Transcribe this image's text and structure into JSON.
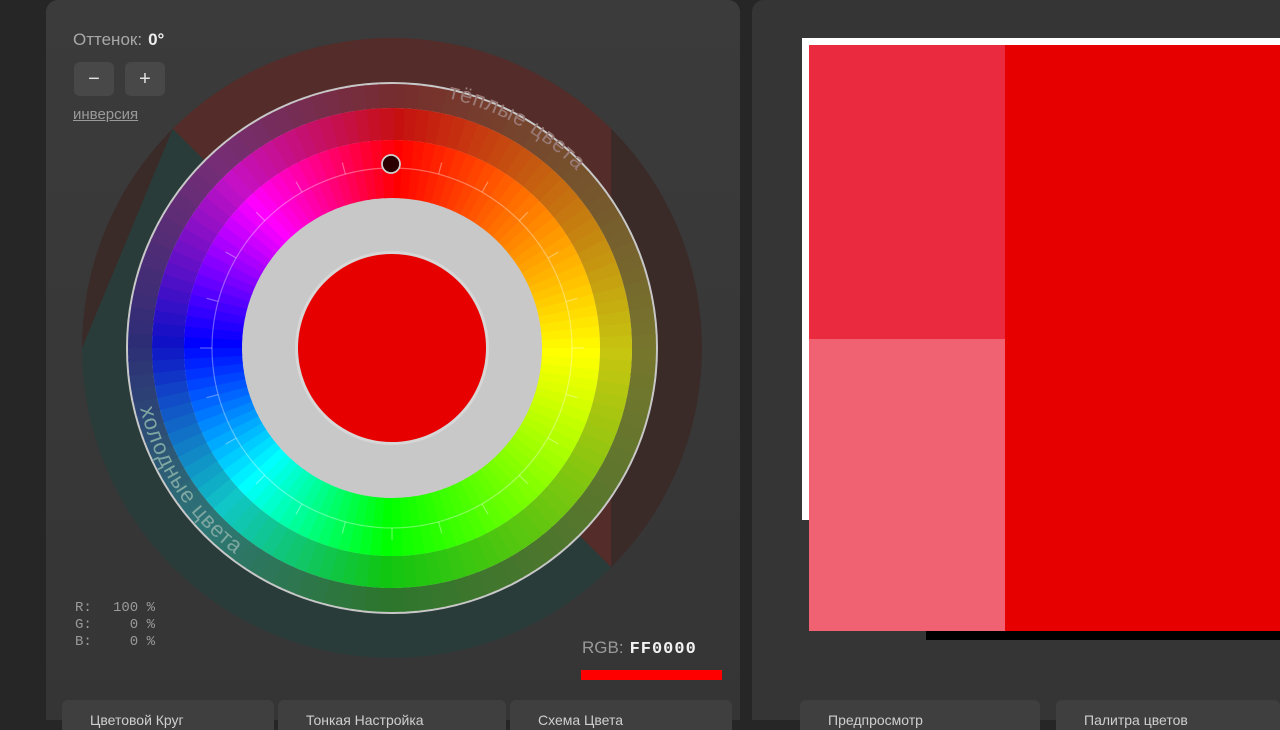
{
  "hue": {
    "label": "Оттенок:",
    "value": "0°"
  },
  "buttons": {
    "minus": "−",
    "plus": "+"
  },
  "invert_label": "инверсия",
  "wheel": {
    "warm_label": "тёплые цвета",
    "cold_label": "холодные цвета",
    "selected_hue_deg": 0,
    "center_color": "#e60000"
  },
  "rgb": [
    {
      "channel": "R:",
      "value": "100 %"
    },
    {
      "channel": "G:",
      "value": "0 %"
    },
    {
      "channel": "B:",
      "value": "0 %"
    }
  ],
  "hex": {
    "label": "RGB:",
    "value": "FF0000",
    "color": "#ff0000"
  },
  "tabs": [
    {
      "label": "Цветовой Круг"
    },
    {
      "label": "Тонкая Настройка"
    },
    {
      "label": "Схема Цвета"
    }
  ],
  "right_tabs": [
    {
      "label": "Предпросмотр"
    },
    {
      "label": "Палитра цветов"
    }
  ],
  "swatches": {
    "top_left": "#ea2a3e",
    "bottom_left": "#f06272",
    "main": "#e60000"
  }
}
